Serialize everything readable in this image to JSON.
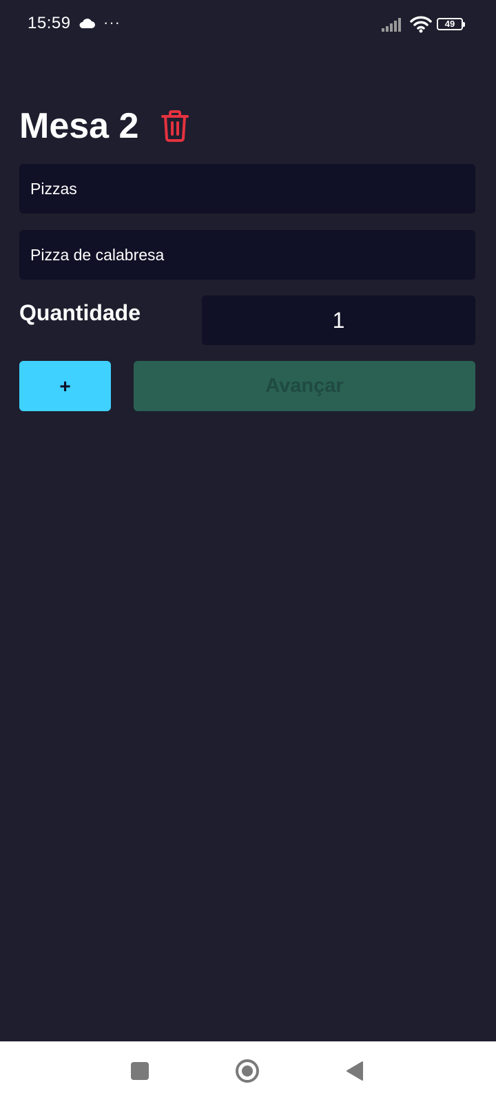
{
  "status_bar": {
    "time": "15:59",
    "battery_level": "49",
    "icons": [
      "cloud-icon",
      "more-dots-icon",
      "signal-icon",
      "wifi-icon",
      "battery-icon"
    ]
  },
  "header": {
    "title": "Mesa 2",
    "delete_icon": "trash-icon",
    "delete_color": "#e5323f"
  },
  "form": {
    "category_value": "Pizzas",
    "product_value": "Pizza de calabresa",
    "quantity_label": "Quantidade",
    "quantity_value": "1"
  },
  "actions": {
    "add_label": "+",
    "next_label": "Avançar",
    "add_color": "#3fd1ff",
    "next_color": "#2a6153"
  },
  "nav_bar": {
    "icons": [
      "recent-apps-icon",
      "home-icon",
      "back-icon"
    ]
  },
  "colors": {
    "background": "#1e1e2e",
    "field_background": "#101026"
  }
}
